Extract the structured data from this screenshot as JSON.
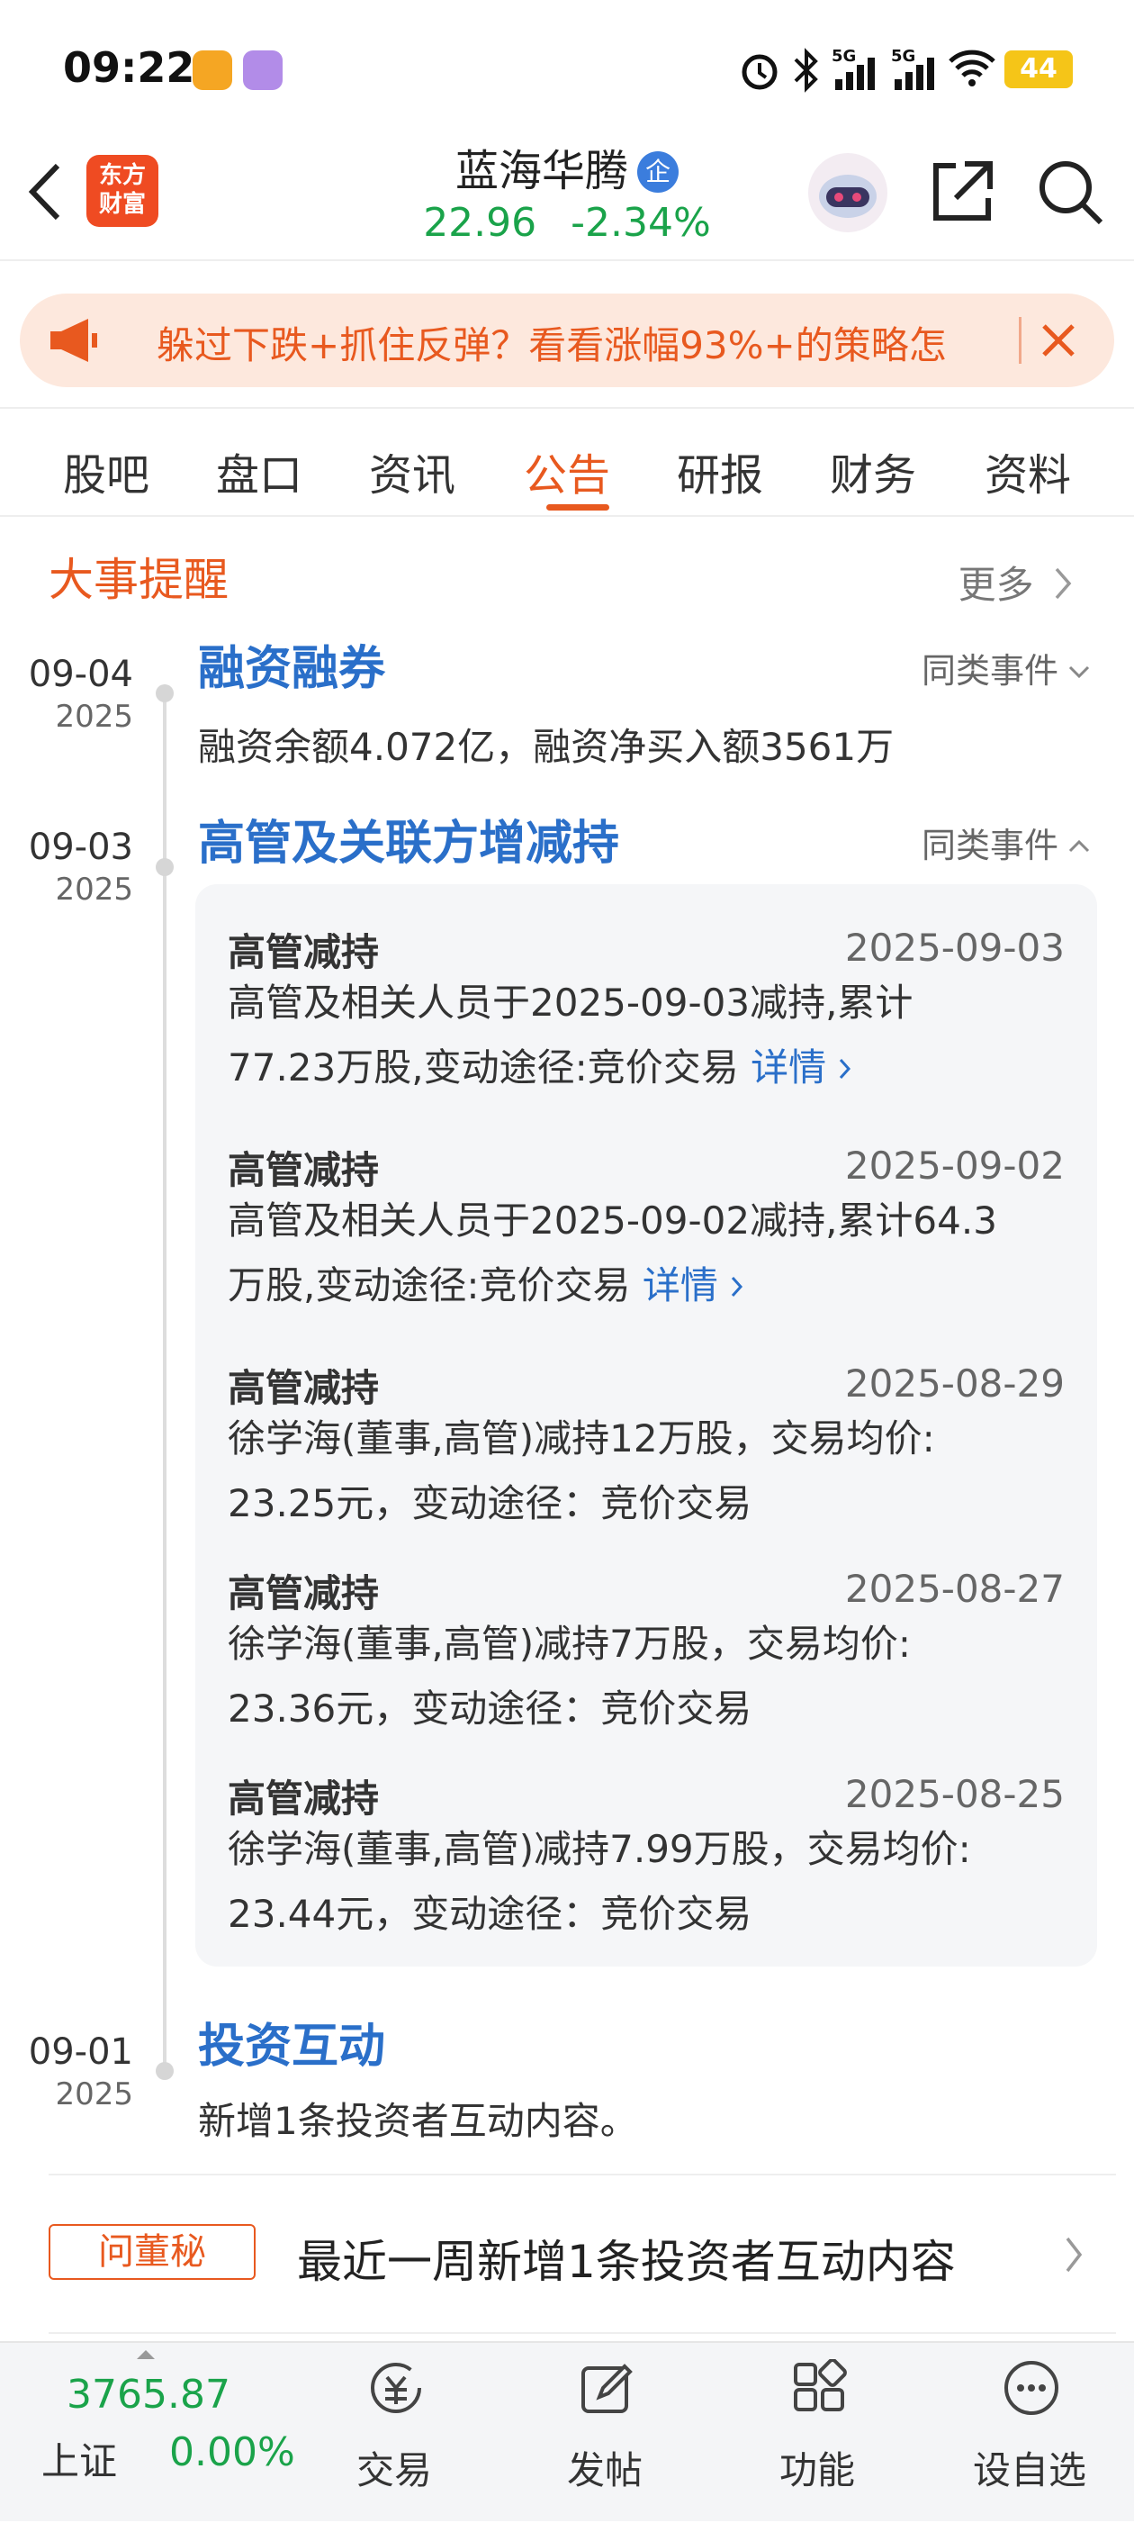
{
  "status_bar": {
    "time": "09:22",
    "battery": "44",
    "signal_1": "5G",
    "signal_2": "5G"
  },
  "header": {
    "logo_line1": "东方",
    "logo_line2": "财富",
    "stock_name": "蓝海华腾",
    "stock_tag": "企",
    "price": "22.96",
    "change": "-2.34%"
  },
  "banner": {
    "text": "躲过下跌+抓住反弹？看看涨幅93%+的策略怎"
  },
  "tabs": [
    "股吧",
    "盘口",
    "资讯",
    "公告",
    "研报",
    "财务",
    "资料"
  ],
  "active_tab": "公告",
  "section": {
    "title": "大事提醒",
    "more": "更多"
  },
  "events": [
    {
      "date": "09-04",
      "year": "2025",
      "title": "融资融券",
      "same": "同类事件",
      "text": "融资余额4.072亿，融资净买入额3561万"
    },
    {
      "date": "09-03",
      "year": "2025",
      "title": "高管及关联方增减持",
      "same": "同类事件"
    },
    {
      "date": "09-01",
      "year": "2025",
      "title": "投资互动",
      "text": "新增1条投资者互动内容。"
    }
  ],
  "holdings": [
    {
      "title": "高管减持",
      "date": "2025-09-03",
      "line1": "高管及相关人员于2025-09-03减持,累计",
      "line2": "77.23万股,变动途径:竞价交易",
      "link": "详情"
    },
    {
      "title": "高管减持",
      "date": "2025-09-02",
      "line1": "高管及相关人员于2025-09-02减持,累计64.3",
      "line2": "万股,变动途径:竞价交易",
      "link": "详情"
    },
    {
      "title": "高管减持",
      "date": "2025-08-29",
      "line1": "徐学海(董事,高管)减持12万股，交易均价:",
      "line2": "23.25元，变动途径：竞价交易"
    },
    {
      "title": "高管减持",
      "date": "2025-08-27",
      "line1": "徐学海(董事,高管)减持7万股，交易均价:",
      "line2": "23.36元，变动途径：竞价交易"
    },
    {
      "title": "高管减持",
      "date": "2025-08-25",
      "line1": "徐学海(董事,高管)减持7.99万股，交易均价:",
      "line2": "23.44元，变动途径：竞价交易"
    }
  ],
  "dongmi": {
    "tag": "问董秘",
    "text": "最近一周新增1条投资者互动内容"
  },
  "bottom": {
    "index_value": "3765.87",
    "index_name": "上证",
    "index_pct": "0.00%",
    "nav": [
      "交易",
      "发帖",
      "功能",
      "设自选"
    ]
  },
  "colors": {
    "accent": "#e8591f",
    "down": "#1aa34a",
    "link": "#2a6fc9"
  }
}
